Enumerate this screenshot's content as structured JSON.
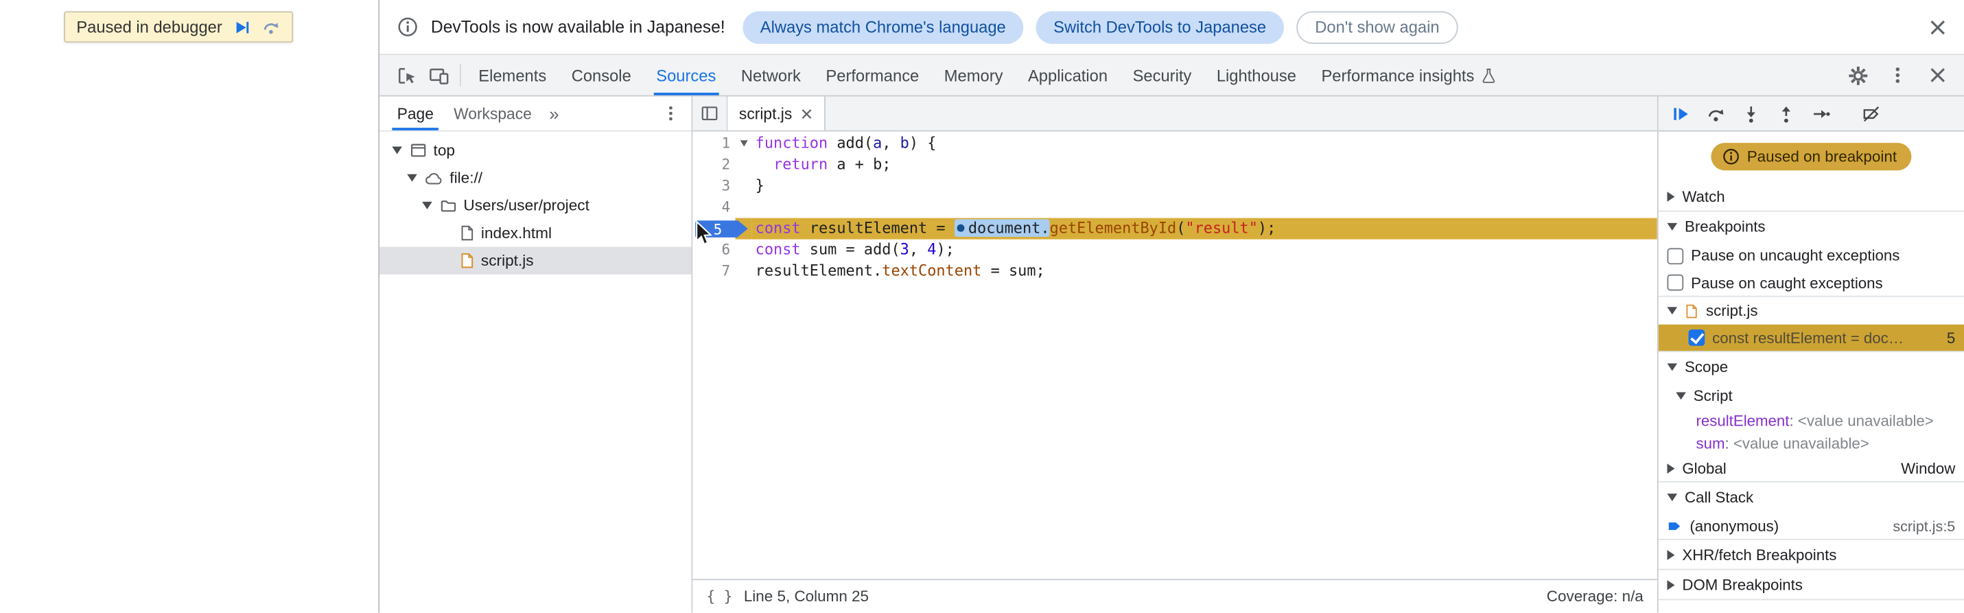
{
  "colors": {
    "accent": "#1a73e8",
    "toolbar_bg": "#f1f3f4",
    "paused_line_gold": "#d8ae3a",
    "paused_badge_gold": "#d2a63c",
    "token_keyword": "#9334e6",
    "token_string": "#c5221f",
    "token_number": "#1c00cf",
    "token_property": "#994500",
    "selection_blue": "#a8cdf0"
  },
  "page": {
    "paused_banner": {
      "text": "Paused in debugger"
    }
  },
  "notification": {
    "message": "DevTools is now available in Japanese!",
    "buttons": [
      "Always match Chrome's language",
      "Switch DevTools to Japanese",
      "Don't show again"
    ]
  },
  "toolbar": {
    "tabs": [
      {
        "label": "Elements",
        "active": false
      },
      {
        "label": "Console",
        "active": false
      },
      {
        "label": "Sources",
        "active": true
      },
      {
        "label": "Network",
        "active": false
      },
      {
        "label": "Performance",
        "active": false
      },
      {
        "label": "Memory",
        "active": false
      },
      {
        "label": "Application",
        "active": false
      },
      {
        "label": "Security",
        "active": false
      },
      {
        "label": "Lighthouse",
        "active": false
      },
      {
        "label": "Performance insights",
        "active": false
      }
    ]
  },
  "navigator": {
    "tabs": [
      {
        "label": "Page",
        "active": true
      },
      {
        "label": "Workspace",
        "active": false
      }
    ],
    "overflow_symbol": "»",
    "tree": [
      {
        "label": "top"
      },
      {
        "label": "file://"
      },
      {
        "label": "Users/user/project"
      },
      {
        "label": "index.html"
      },
      {
        "label": "script.js",
        "selected": true
      }
    ]
  },
  "editor": {
    "tab_label": "script.js",
    "lines": [
      {
        "num": 1,
        "fold": true,
        "tokens": [
          {
            "t": "function",
            "c": "kw"
          },
          {
            "t": " add(",
            "c": ""
          },
          {
            "t": "a",
            "c": "def"
          },
          {
            "t": ", ",
            "c": ""
          },
          {
            "t": "b",
            "c": "def"
          },
          {
            "t": ") {",
            "c": ""
          }
        ]
      },
      {
        "num": 2,
        "tokens": [
          {
            "t": "  ",
            "c": ""
          },
          {
            "t": "return",
            "c": "kw"
          },
          {
            "t": " a + b;",
            "c": ""
          }
        ]
      },
      {
        "num": 3,
        "tokens": [
          {
            "t": "}",
            "c": ""
          }
        ]
      },
      {
        "num": 4,
        "tokens": []
      },
      {
        "num": 5,
        "paused": true,
        "tokens": [
          {
            "t": "const",
            "c": "kw"
          },
          {
            "t": " resultElement = ",
            "c": ""
          },
          {
            "t": "document.",
            "c": "sel"
          },
          {
            "t": "getElementById",
            "c": "prop"
          },
          {
            "t": "(",
            "c": ""
          },
          {
            "t": "\"result\"",
            "c": "str"
          },
          {
            "t": ");",
            "c": ""
          }
        ]
      },
      {
        "num": 6,
        "tokens": [
          {
            "t": "const",
            "c": "kw"
          },
          {
            "t": " sum = add(",
            "c": ""
          },
          {
            "t": "3",
            "c": "num"
          },
          {
            "t": ", ",
            "c": ""
          },
          {
            "t": "4",
            "c": "num"
          },
          {
            "t": ");",
            "c": ""
          }
        ]
      },
      {
        "num": 7,
        "tokens": [
          {
            "t": "resultElement.",
            "c": ""
          },
          {
            "t": "textContent",
            "c": "prop"
          },
          {
            "t": " = sum;",
            "c": ""
          }
        ]
      }
    ],
    "status": {
      "position": "Line 5, Column 25",
      "coverage": "Coverage: n/a"
    }
  },
  "debugger": {
    "paused_badge": "Paused on breakpoint",
    "sections": {
      "watch": "Watch",
      "breakpoints": "Breakpoints",
      "scope": "Scope",
      "call_stack": "Call Stack",
      "xhr": "XHR/fetch Breakpoints",
      "dom": "DOM Breakpoints"
    },
    "pause_uncaught": "Pause on uncaught exceptions",
    "pause_caught": "Pause on caught exceptions",
    "breakpoint_group": "script.js",
    "breakpoint_entry": {
      "label": "const resultElement = doc…",
      "line": "5",
      "checked": true
    },
    "scope": {
      "script_label": "Script",
      "variables": [
        {
          "name": "resultElement",
          "value": "<value unavailable>"
        },
        {
          "name": "sum",
          "value": "<value unavailable>"
        }
      ],
      "global_label": "Global",
      "global_value": "Window"
    },
    "call_stack_frames": [
      {
        "name": "(anonymous)",
        "location": "script.js:5"
      }
    ]
  }
}
